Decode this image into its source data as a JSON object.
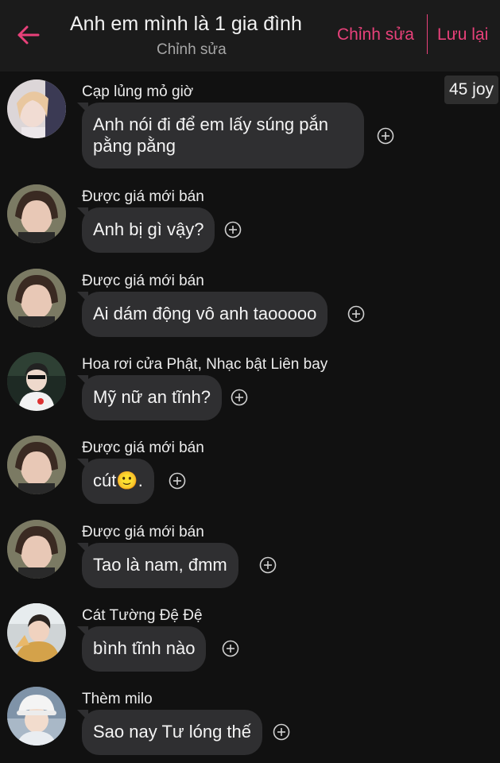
{
  "header": {
    "title": "Anh em mình là 1 gia đình",
    "subtitle": "Chỉnh sửa",
    "edit_label": "Chỉnh sửa",
    "save_label": "Lưu lại",
    "back_icon": "back-arrow-icon",
    "accent_color": "#e8417a"
  },
  "badge": {
    "joy": "45 joy"
  },
  "messages": [
    {
      "sender": "Cạp lủng mỏ giờ",
      "line1": "Anh nói đi để em lấy súng pắn",
      "line2": "pằng pằng"
    },
    {
      "sender": "Được giá mới bán",
      "text": "Anh bị gì vậy?"
    },
    {
      "sender": "Được giá mới bán",
      "text": "Ai dám động vô anh taooooo"
    },
    {
      "sender": "Hoa rơi cửa Phật, Nhạc bật Liên bay",
      "text": "Mỹ nữ an tĩnh?"
    },
    {
      "sender": "Được giá mới bán",
      "text": "cút",
      "emoji": "🙂",
      "after": "."
    },
    {
      "sender": "Được giá mới bán",
      "text": "Tao là nam, đmm"
    },
    {
      "sender": "Cát Tường Đệ Đệ",
      "text": "bình tĩnh nào"
    },
    {
      "sender": "Thèm milo",
      "text": "Sao nay Tư lóng thế"
    }
  ]
}
